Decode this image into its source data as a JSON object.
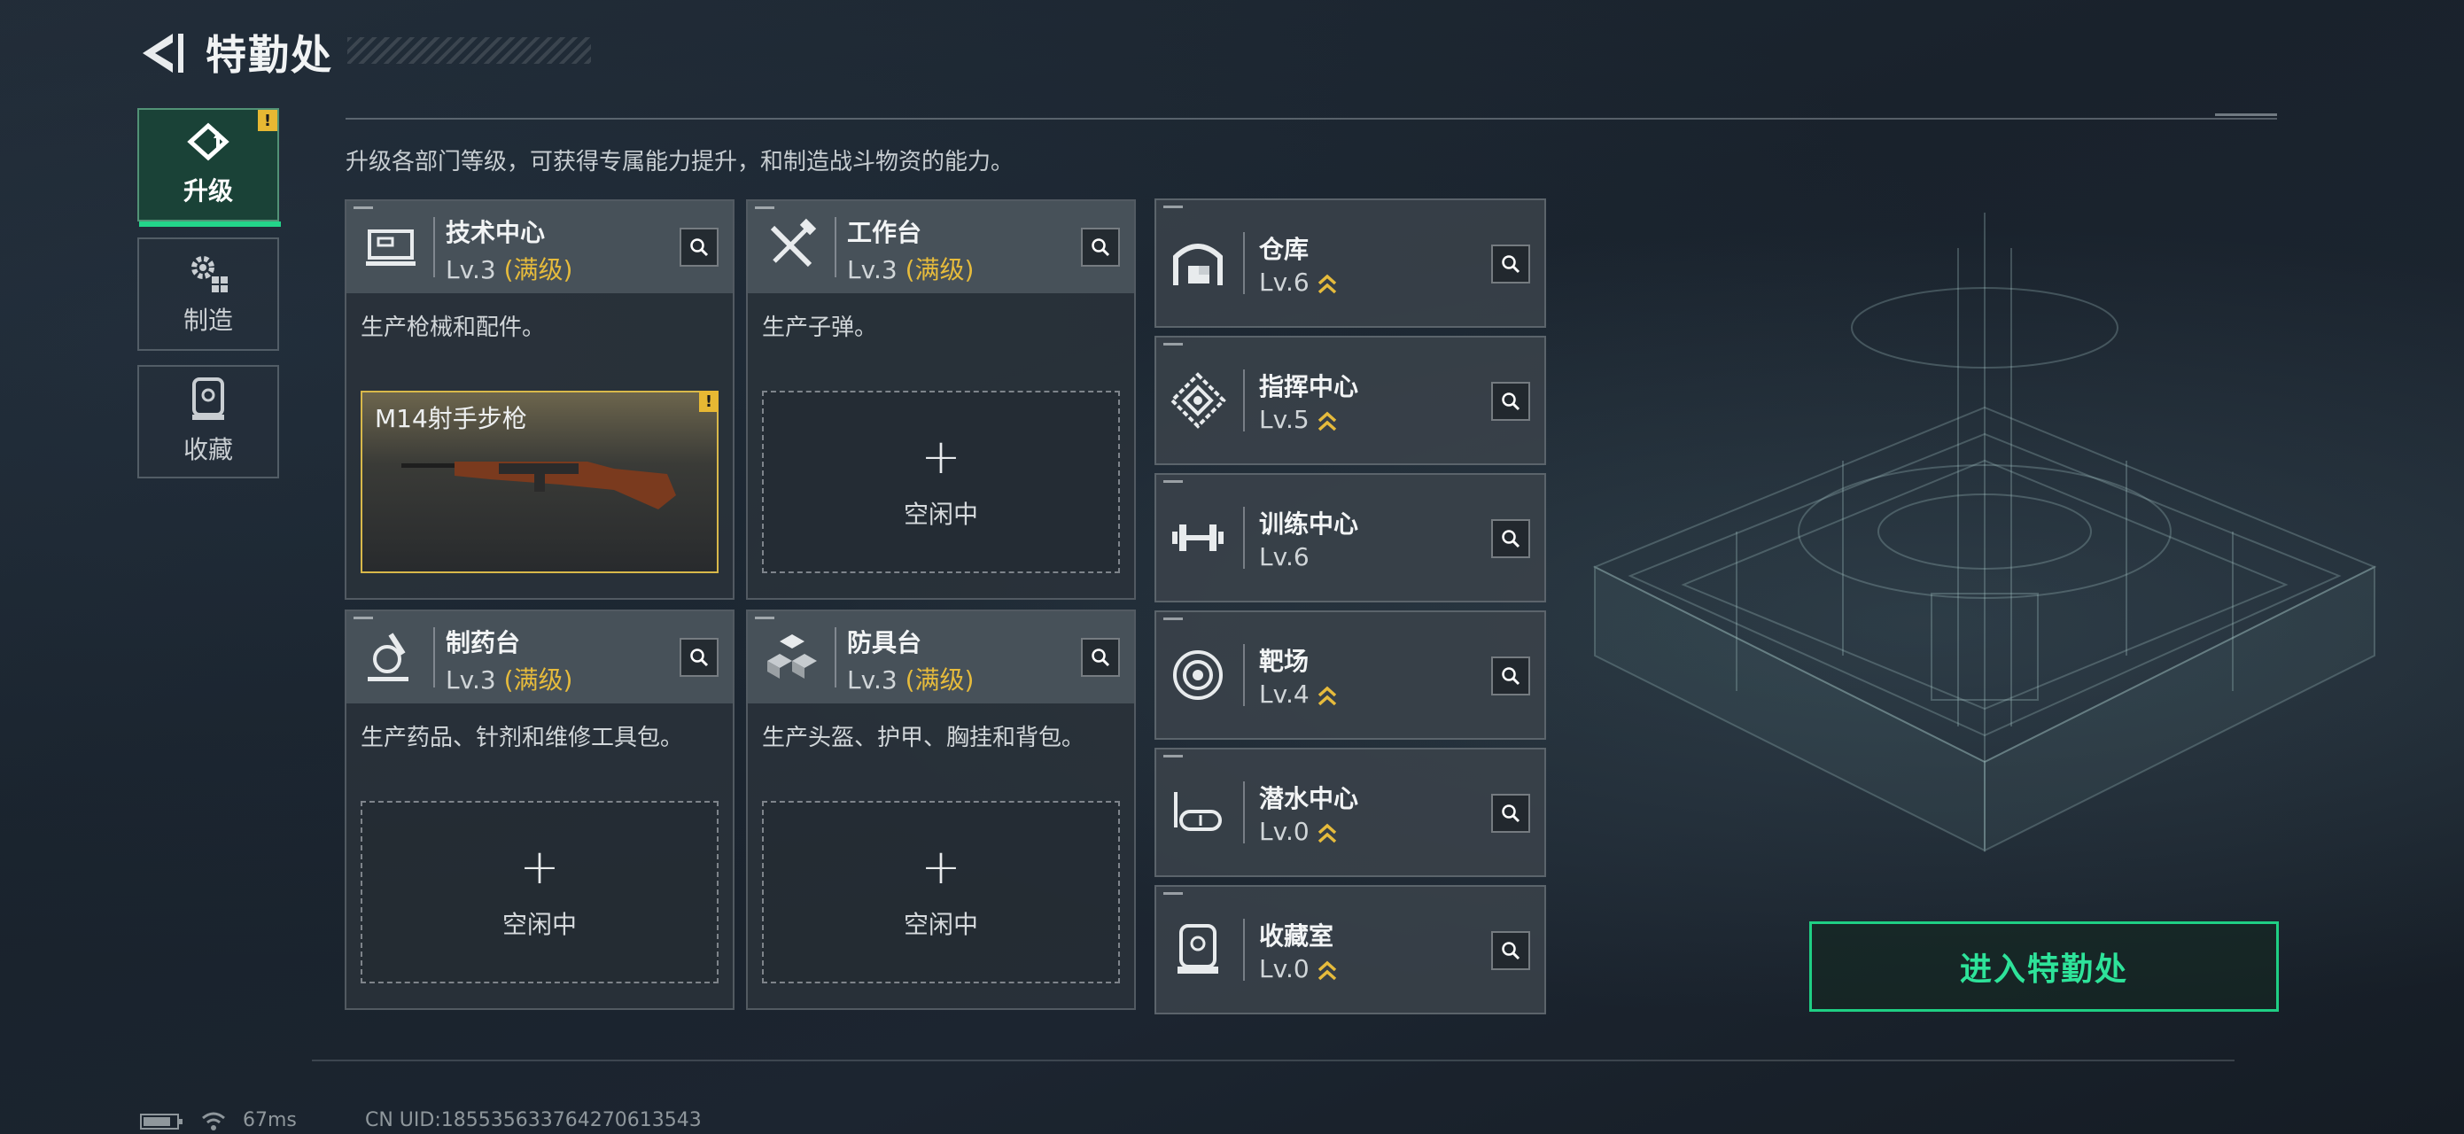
{
  "header": {
    "title": "特勤处"
  },
  "sidebar": {
    "tabs": [
      {
        "label": "升级",
        "icon": "upgrade-icon",
        "active": true,
        "alert": "!"
      },
      {
        "label": "制造",
        "icon": "gears-icon",
        "active": false
      },
      {
        "label": "收藏",
        "icon": "collection-icon",
        "active": false
      }
    ]
  },
  "description": "升级各部门等级，可获得专属能力提升，和制造战斗物资的能力。",
  "workstations": [
    {
      "name": "技术中心",
      "level": "Lv.3",
      "max": "(满级)",
      "icon": "tech-center-icon",
      "desc": "生产枪械和配件。",
      "slot": {
        "type": "item",
        "item_name": "M14射手步枪",
        "alert": "!"
      }
    },
    {
      "name": "工作台",
      "level": "Lv.3",
      "max": "(满级)",
      "icon": "workbench-icon",
      "desc": "生产子弹。",
      "slot": {
        "type": "idle",
        "plus": "+",
        "label": "空闲中"
      }
    },
    {
      "name": "制药台",
      "level": "Lv.3",
      "max": "(满级)",
      "icon": "pharmacy-icon",
      "desc": "生产药品、针剂和维修工具包。",
      "slot": {
        "type": "idle",
        "plus": "+",
        "label": "空闲中"
      }
    },
    {
      "name": "防具台",
      "level": "Lv.3",
      "max": "(满级)",
      "icon": "armor-bench-icon",
      "desc": "生产头盔、护甲、胸挂和背包。",
      "slot": {
        "type": "idle",
        "plus": "+",
        "label": "空闲中"
      }
    }
  ],
  "facilities": [
    {
      "name": "仓库",
      "level": "Lv.6",
      "icon": "warehouse-icon",
      "upgradable": true
    },
    {
      "name": "指挥中心",
      "level": "Lv.5",
      "icon": "command-center-icon",
      "upgradable": true
    },
    {
      "name": "训练中心",
      "level": "Lv.6",
      "icon": "dumbbell-icon",
      "upgradable": false
    },
    {
      "name": "靶场",
      "level": "Lv.4",
      "icon": "target-icon",
      "upgradable": true
    },
    {
      "name": "潜水中心",
      "level": "Lv.0",
      "icon": "diving-mask-icon",
      "upgradable": true
    },
    {
      "name": "收藏室",
      "level": "Lv.0",
      "icon": "collection-room-icon",
      "upgradable": true
    }
  ],
  "enter_button": {
    "label": "进入特勤处"
  },
  "status_bar": {
    "ping": "67ms",
    "uid": "CN UID:1855356337642706135​43"
  },
  "colors": {
    "accent_green": "#23d58a",
    "max_gold": "#e6bb3c",
    "panel": "#2a323a"
  }
}
